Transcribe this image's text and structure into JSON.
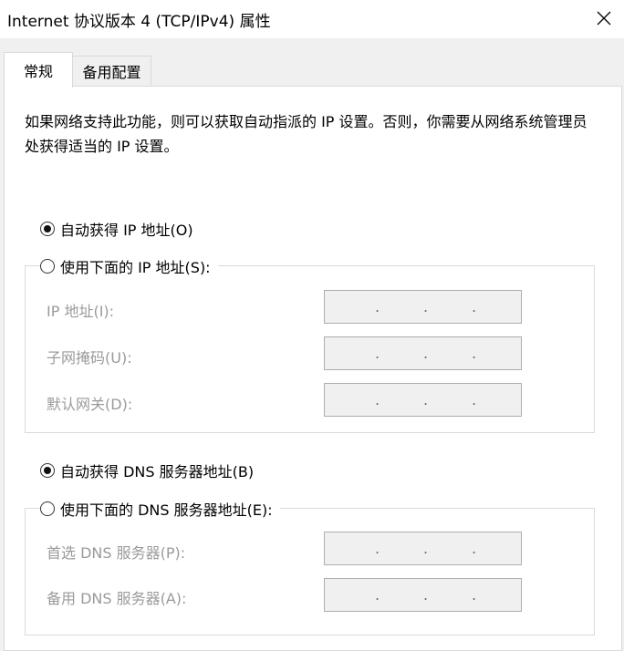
{
  "window": {
    "title": "Internet 协议版本 4 (TCP/IPv4) 属性"
  },
  "icons": {
    "close": "close-icon"
  },
  "tabs": [
    {
      "label": "常规",
      "active": true
    },
    {
      "label": "备用配置",
      "active": false
    }
  ],
  "description": "如果网络支持此功能，则可以获取自动指派的 IP 设置。否则，你需要从网络系统管理员处获得适当的 IP 设置。",
  "ip_settings": {
    "auto_label": "自动获得 IP 地址(O)",
    "auto_selected": true,
    "manual_label": "使用下面的 IP 地址(S):",
    "manual_selected": false,
    "fields": [
      {
        "label": "IP 地址(I):",
        "value": ""
      },
      {
        "label": "子网掩码(U):",
        "value": ""
      },
      {
        "label": "默认网关(D):",
        "value": ""
      }
    ]
  },
  "dns_settings": {
    "auto_label": "自动获得 DNS 服务器地址(B)",
    "auto_selected": true,
    "manual_label": "使用下面的 DNS 服务器地址(E):",
    "manual_selected": false,
    "fields": [
      {
        "label": "首选 DNS 服务器(P):",
        "value": ""
      },
      {
        "label": "备用 DNS 服务器(A):",
        "value": ""
      }
    ]
  },
  "ip_separator": "."
}
